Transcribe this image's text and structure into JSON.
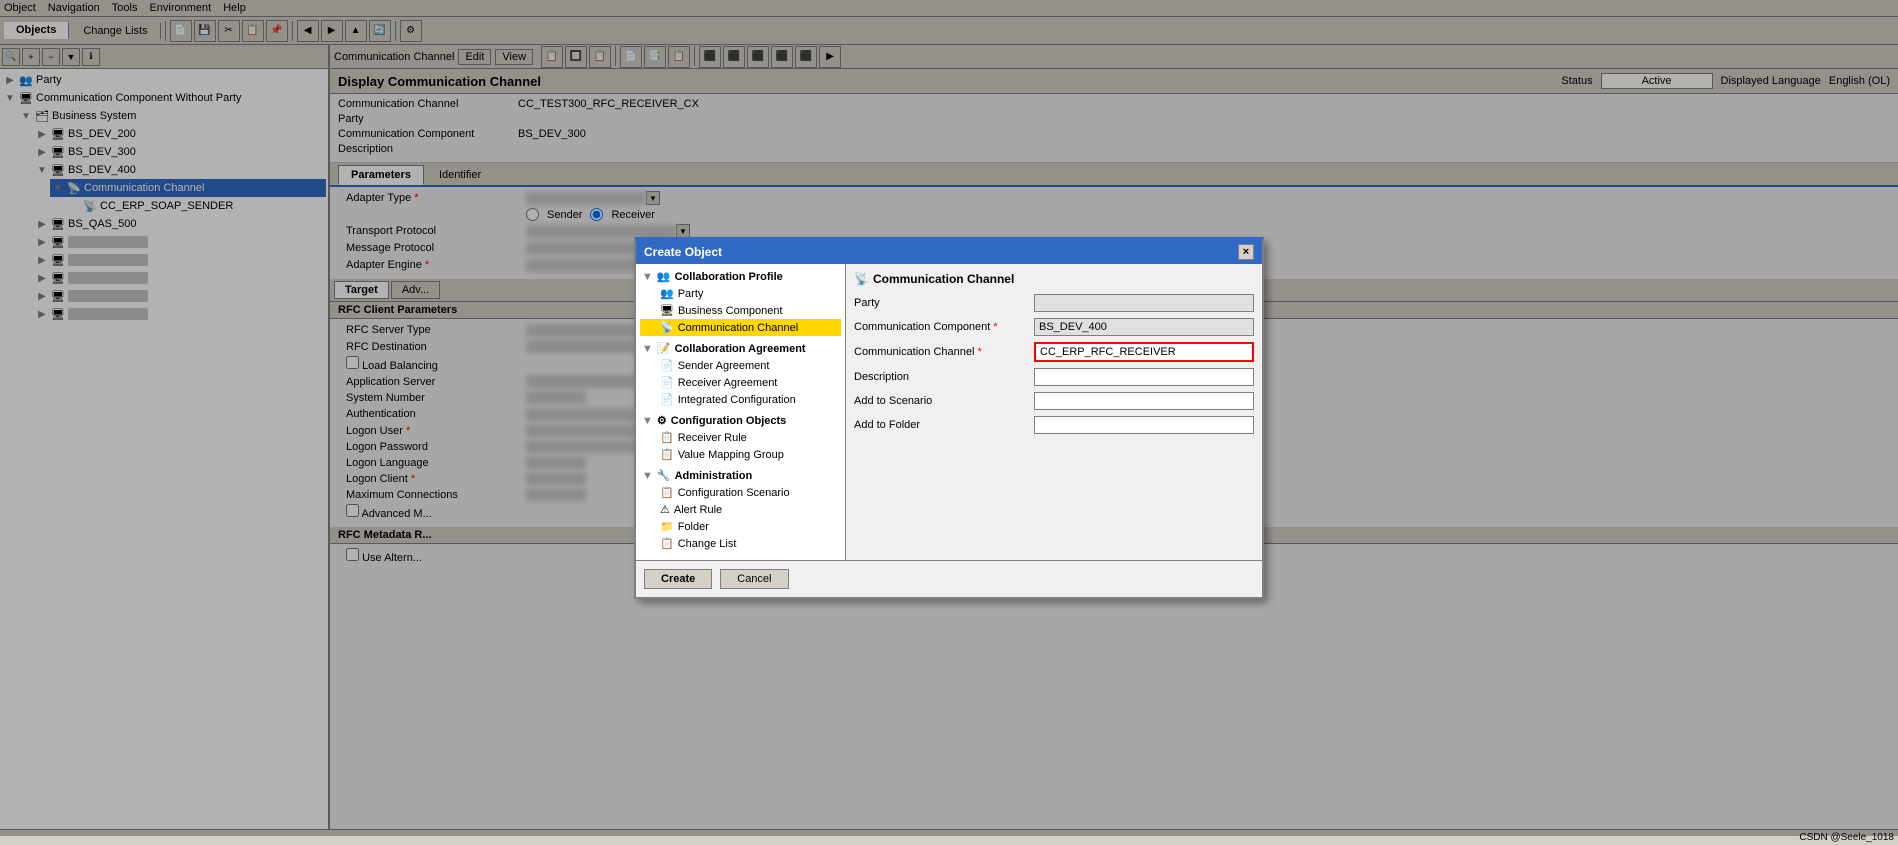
{
  "menu": {
    "items": [
      "Object",
      "Navigation",
      "Tools",
      "Environment",
      "Help"
    ]
  },
  "toolbar": {
    "tabs": {
      "objects": "Objects",
      "change_lists": "Change Lists"
    }
  },
  "left_panel": {
    "tree": {
      "party": "Party",
      "comm_component": "Communication Component Without Party",
      "business_system": "Business System",
      "bs_dev_200": "BS_DEV_200",
      "bs_dev_300": "BS_DEV_300",
      "bs_dev_400": "BS_DEV_400",
      "communication_channel": "Communication Channel",
      "cc_erp_soap_sender": "CC_ERP_SOAP_SENDER",
      "bs_qas_500": "BS_QAS_500"
    }
  },
  "right_panel": {
    "header": {
      "title": "Display Communication Channel",
      "status_label": "Status",
      "status_value": "Active",
      "display_language_label": "Displayed Language",
      "display_language_value": "English (OL)"
    },
    "form": {
      "comm_channel_label": "Communication Channel",
      "comm_channel_value": "CC_TEST300_RFC_RECEIVER_CX",
      "party_label": "Party",
      "comm_component_label": "Communication Component",
      "comm_component_value": "BS_DEV_300",
      "description_label": "Description"
    },
    "tabs": {
      "parameters": "Parameters",
      "identifier": "Identifier"
    },
    "parameters": {
      "adapter_type_label": "Adapter Type",
      "adapter_type_required": "*",
      "sender_label": "Sender",
      "receiver_label": "Receiver",
      "transport_protocol_label": "Transport Protocol",
      "message_protocol_label": "Message Protocol",
      "adapter_engine_label": "Adapter Engine",
      "adapter_engine_required": "*"
    },
    "content_tabs": {
      "target": "Target",
      "advanced": "Adv..."
    },
    "rfc_section": {
      "title": "RFC Client Parameters",
      "rfc_server_type_label": "RFC Server Type",
      "rfc_destination_label": "RFC Destination",
      "load_balancing_label": "Load Balancing",
      "application_server_label": "Application Server",
      "system_number_label": "System Number",
      "authentication_label": "Authentication",
      "logon_user_label": "Logon User",
      "logon_user_required": "*",
      "logon_password_label": "Logon Password",
      "logon_language_label": "Logon Language",
      "logon_client_label": "Logon Client",
      "logon_client_required": "*",
      "max_connections_label": "Maximum Connections",
      "advanced_label": "Advanced M..."
    },
    "rfc_metadata": {
      "title": "RFC Metadata R...",
      "use_alternate_label": "Use Altern..."
    }
  },
  "modal": {
    "title": "Create Object",
    "close_icon": "×",
    "tree": {
      "collaboration_profile": "Collaboration Profile",
      "party": "Party",
      "business_component": "Business Component",
      "communication_channel_item": "Communication Channel",
      "collaboration_agreement": "Collaboration Agreement",
      "sender_agreement": "Sender Agreement",
      "receiver_agreement": "Receiver Agreement",
      "integrated_configuration": "Integrated Configuration",
      "configuration_objects": "Configuration Objects",
      "receiver_rule": "Receiver Rule",
      "value_mapping_group": "Value Mapping Group",
      "administration": "Administration",
      "configuration_scenario": "Configuration Scenario",
      "alert_rule": "Alert Rule",
      "folder": "Folder",
      "change_list": "Change List"
    },
    "right_section": {
      "title": "Communication Channel",
      "title_icon": "📡",
      "party_label": "Party",
      "party_value": "",
      "comm_component_label": "Communication Component",
      "comm_component_required": "*",
      "comm_component_value": "BS_DEV_400",
      "comm_channel_label": "Communication Channel",
      "comm_channel_required": "*",
      "comm_channel_value": "CC_ERP_RFC_RECEIVER",
      "description_label": "Description",
      "description_value": "",
      "add_scenario_label": "Add to Scenario",
      "add_scenario_value": "",
      "add_folder_label": "Add to Folder",
      "add_folder_value": ""
    },
    "buttons": {
      "create": "Create",
      "cancel": "Cancel"
    }
  },
  "bottom_bar": {
    "credit": "CSDN @Seele_1018"
  }
}
